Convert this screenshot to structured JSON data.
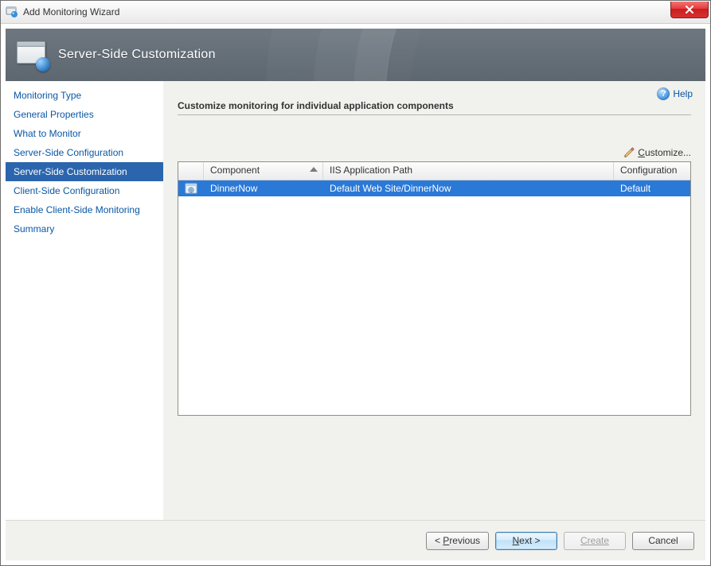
{
  "window": {
    "title": "Add Monitoring Wizard"
  },
  "header": {
    "title": "Server-Side Customization"
  },
  "help": {
    "label": "Help"
  },
  "sidebar": {
    "items": [
      {
        "label": "Monitoring Type"
      },
      {
        "label": "General Properties"
      },
      {
        "label": "What to Monitor"
      },
      {
        "label": "Server-Side Configuration"
      },
      {
        "label": "Server-Side Customization"
      },
      {
        "label": "Client-Side Configuration"
      },
      {
        "label": "Enable Client-Side Monitoring"
      },
      {
        "label": "Summary"
      }
    ],
    "selected_index": 4
  },
  "content": {
    "section_title": "Customize monitoring for individual application components",
    "customize_prefix": "C",
    "customize_rest": "ustomize..."
  },
  "grid": {
    "columns": {
      "component": "Component",
      "path": "IIS Application Path",
      "config": "Configuration"
    },
    "rows": [
      {
        "component": "DinnerNow",
        "path": "Default Web Site/DinnerNow",
        "config": "Default"
      }
    ]
  },
  "footer": {
    "previous_prefix": "< ",
    "previous_ul": "P",
    "previous_rest": "revious",
    "next_prefix": "",
    "next_ul": "N",
    "next_rest": "ext >",
    "create": "Create",
    "cancel": "Cancel"
  }
}
